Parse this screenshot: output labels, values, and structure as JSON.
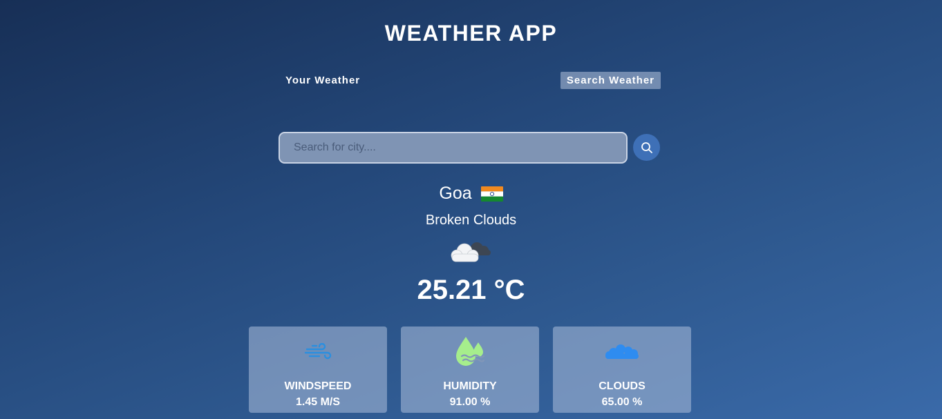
{
  "app": {
    "title": "WEATHER APP"
  },
  "tabs": [
    {
      "label": "Your Weather",
      "active": false
    },
    {
      "label": "Search Weather",
      "active": true
    }
  ],
  "search": {
    "placeholder": "Search for city....",
    "value": "",
    "icon": "search-icon"
  },
  "weather": {
    "city": "Goa",
    "country_flag": "flag-india-icon",
    "description": "Broken Clouds",
    "icon": "broken-clouds-icon",
    "temperature": "25.21 °C"
  },
  "stats": [
    {
      "label": "WINDSPEED",
      "value": "1.45 M/S",
      "icon": "wind-icon"
    },
    {
      "label": "HUMIDITY",
      "value": "91.00 %",
      "icon": "humidity-icon"
    },
    {
      "label": "CLOUDS",
      "value": "65.00 %",
      "icon": "cloud-icon"
    }
  ],
  "colors": {
    "accent": "#3e70b7",
    "wind_icon": "#2a8fe0",
    "humidity_icon": "#a6ee8c",
    "cloud_icon": "#2e8cf0"
  }
}
